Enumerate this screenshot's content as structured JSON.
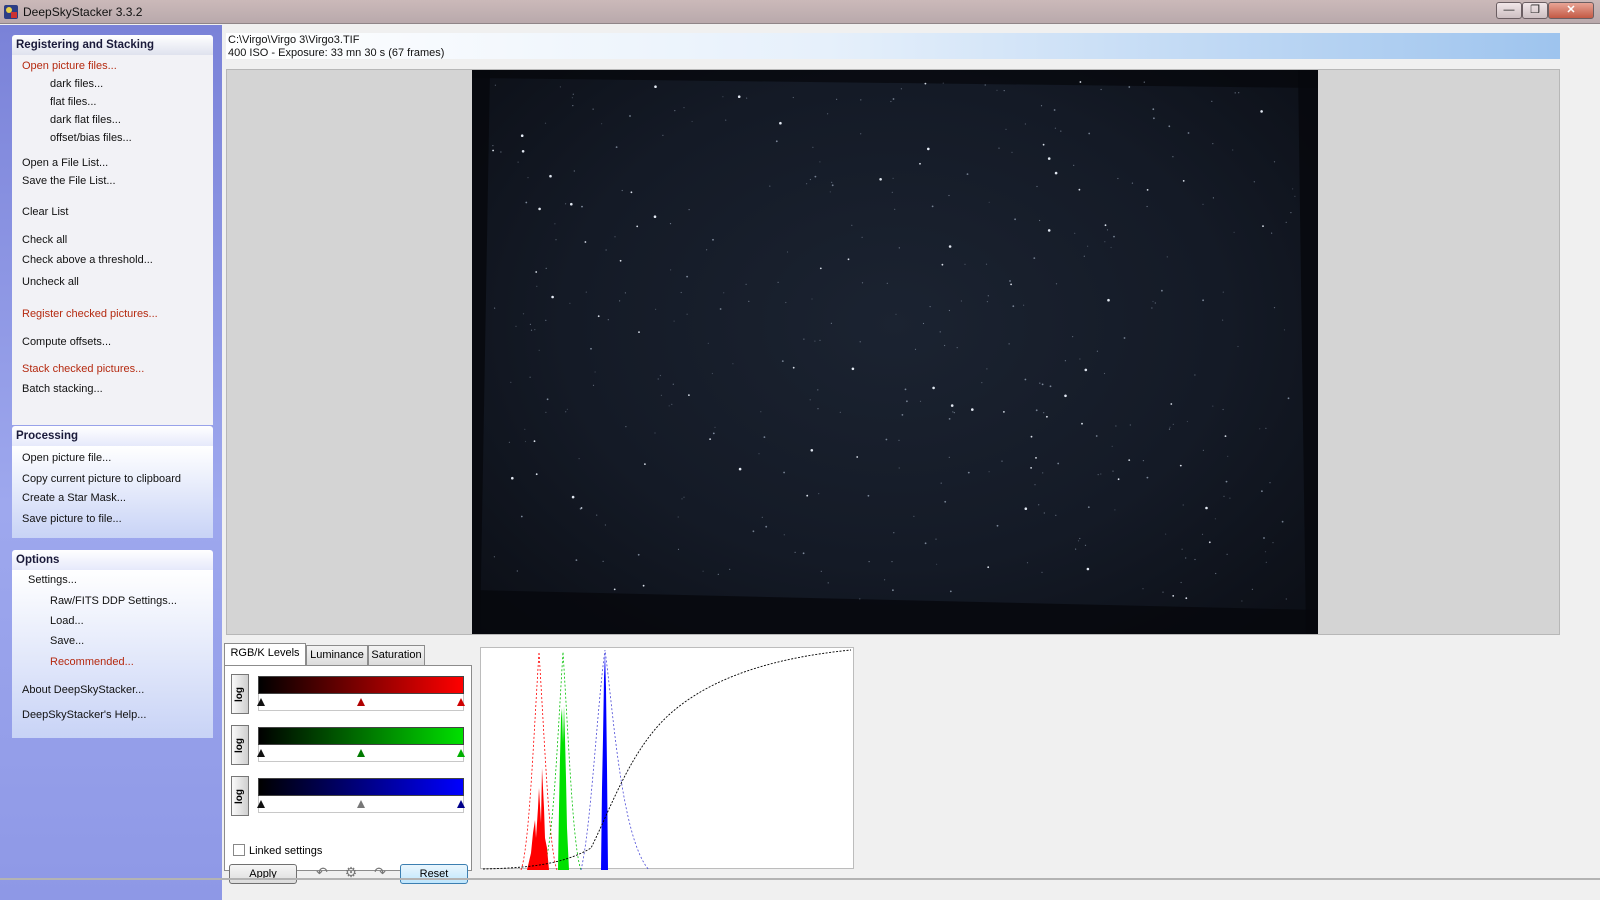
{
  "window": {
    "title": "DeepSkyStacker 3.3.2",
    "buttons": {
      "minimize": "—",
      "maximize": "❐",
      "close": "✕"
    }
  },
  "sidebar": {
    "registering": {
      "header": "Registering and Stacking",
      "items": [
        {
          "label": "Open picture files...",
          "highlight": true
        },
        {
          "label": "dark files...",
          "highlight": false
        },
        {
          "label": "flat files...",
          "highlight": false
        },
        {
          "label": "dark flat files...",
          "highlight": false
        },
        {
          "label": "offset/bias files...",
          "highlight": false
        },
        {
          "label": "Open a File List...",
          "highlight": false
        },
        {
          "label": "Save the File List...",
          "highlight": false
        },
        {
          "label": "Clear List",
          "highlight": false
        },
        {
          "label": "Check all",
          "highlight": false
        },
        {
          "label": "Check above a threshold...",
          "highlight": false
        },
        {
          "label": "Uncheck all",
          "highlight": false
        },
        {
          "label": "Register checked pictures...",
          "highlight": true
        },
        {
          "label": "Compute offsets...",
          "highlight": false
        },
        {
          "label": "Stack checked pictures...",
          "highlight": true
        },
        {
          "label": "Batch stacking...",
          "highlight": false
        }
      ]
    },
    "processing": {
      "header": "Processing",
      "items": [
        {
          "label": "Open picture file..."
        },
        {
          "label": "Copy current picture to clipboard"
        },
        {
          "label": "Create a Star Mask..."
        },
        {
          "label": "Save picture to file..."
        }
      ]
    },
    "options": {
      "header": "Options",
      "items": [
        {
          "label": "Settings...",
          "highlight": false
        },
        {
          "label": "Raw/FITS DDP Settings...",
          "highlight": false
        },
        {
          "label": "Load...",
          "highlight": false
        },
        {
          "label": "Save...",
          "highlight": false
        },
        {
          "label": "Recommended...",
          "highlight": true
        },
        {
          "label": "About DeepSkyStacker...",
          "highlight": false
        },
        {
          "label": "DeepSkyStacker's Help...",
          "highlight": false
        }
      ]
    }
  },
  "info": {
    "path": "C:\\Virgo\\Virgo 3\\Virgo3.TIF",
    "details": "400 ISO - Exposure: 33 mn 30 s (67 frames)"
  },
  "levels": {
    "tabs": [
      "RGB/K Levels",
      "Luminance",
      "Saturation"
    ],
    "active_tab": "RGB/K Levels",
    "log_label": "log",
    "channels": [
      {
        "name": "red",
        "color": "#ff0000",
        "black_point": 0.0,
        "midtone": 0.5,
        "white_point": 1.0
      },
      {
        "name": "green",
        "color": "#00e000",
        "black_point": 0.0,
        "midtone": 0.5,
        "white_point": 1.0
      },
      {
        "name": "blue",
        "color": "#0000ff",
        "black_point": 0.0,
        "midtone": 0.5,
        "white_point": 1.0
      }
    ],
    "linked_label": "Linked settings",
    "linked_checked": false,
    "apply_label": "Apply",
    "reset_label": "Reset",
    "tool_icons": [
      "undo-icon",
      "settings-gear-icon",
      "redo-icon"
    ]
  },
  "histogram": {
    "series": [
      "red",
      "green",
      "blue"
    ],
    "colors": {
      "red": "#ff0000",
      "green": "#00d000",
      "blue": "#0000ff",
      "curve": "#000000"
    }
  }
}
